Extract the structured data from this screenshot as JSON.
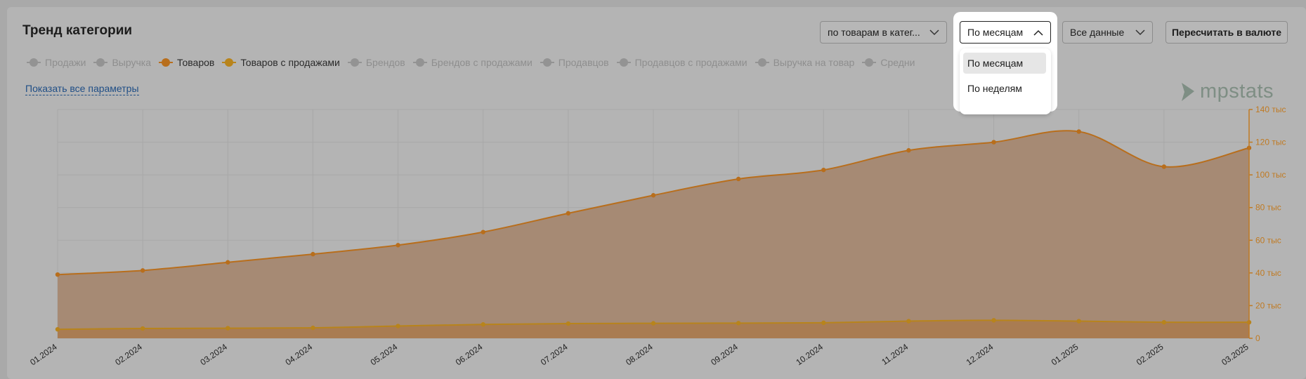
{
  "title": "Тренд категории",
  "controls": {
    "mode_select": "по товарам в катег...",
    "period_select": "По месяцам",
    "data_select": "Все данные",
    "recalc_button": "Пересчитать в валюте"
  },
  "period_menu": {
    "options": [
      {
        "label": "По месяцам",
        "selected": true
      },
      {
        "label": "По неделям",
        "selected": false
      }
    ]
  },
  "legend": [
    {
      "label": "Продажи",
      "active": false
    },
    {
      "label": "Выручка",
      "active": false
    },
    {
      "label": "Товаров",
      "active": true,
      "color": "#b86e1c"
    },
    {
      "label": "Товаров с продажами",
      "active": true,
      "color": "#b8841c"
    },
    {
      "label": "Брендов",
      "active": false
    },
    {
      "label": "Брендов с продажами",
      "active": false
    },
    {
      "label": "Продавцов",
      "active": false
    },
    {
      "label": "Продавцов с продажами",
      "active": false
    },
    {
      "label": "Выручка на товар",
      "active": false
    },
    {
      "label": "Средни",
      "active": false
    }
  ],
  "show_all_link": "Показать все параметры",
  "logo_text": "mpstats",
  "colors": {
    "series_main": "#b86e1c",
    "series_sales": "#b8841c",
    "area_main": "#a68a74",
    "area_sales": "#a97c52",
    "axis": "#c07a22",
    "link": "#1f4e86"
  },
  "chart_data": {
    "type": "area",
    "x": [
      "01.2024",
      "02.2024",
      "03.2024",
      "04.2024",
      "05.2024",
      "06.2024",
      "07.2024",
      "08.2024",
      "09.2024",
      "10.2024",
      "11.2024",
      "12.2024",
      "01.2025",
      "02.2025",
      "03.2025"
    ],
    "series": [
      {
        "name": "Товаров",
        "values": [
          39000,
          41500,
          46500,
          51500,
          57000,
          65000,
          76500,
          87500,
          97500,
          103000,
          115000,
          120000,
          126500,
          105000,
          116500
        ]
      },
      {
        "name": "Товаров с продажами",
        "values": [
          5500,
          6000,
          6200,
          6400,
          7500,
          8500,
          9000,
          9200,
          9300,
          9500,
          10500,
          11000,
          10500,
          9800,
          9800
        ]
      }
    ],
    "y_axis": {
      "position": "right",
      "ylim": [
        0,
        140000
      ],
      "ticks": [
        "0",
        "20 тыс",
        "40 тыс",
        "60 тыс",
        "80 тыс",
        "100 тыс",
        "120 тыс",
        "140 тыс"
      ]
    },
    "grid": true
  }
}
